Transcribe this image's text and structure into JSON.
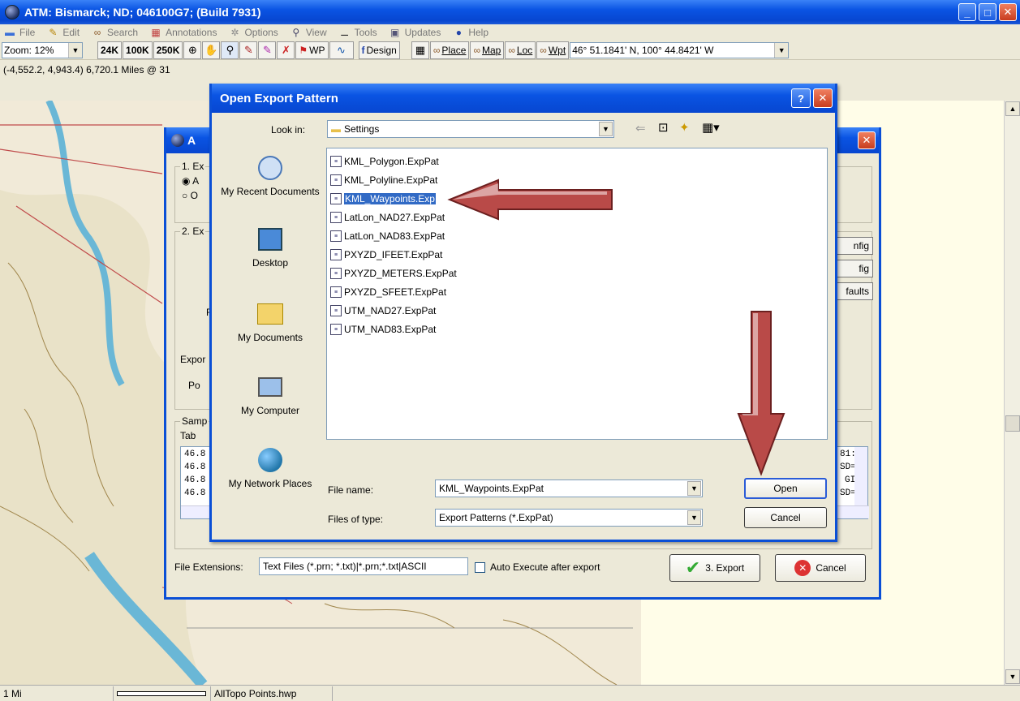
{
  "window": {
    "title": "ATM: Bismarck; ND; 046100G7; (Build 7931)"
  },
  "menu": [
    {
      "label": "File",
      "icon": "folder-icon"
    },
    {
      "label": "Edit",
      "icon": "edit-icon"
    },
    {
      "label": "Search",
      "icon": "binoculars-icon"
    },
    {
      "label": "Annotations",
      "icon": "annotations-icon"
    },
    {
      "label": "Options",
      "icon": "options-icon"
    },
    {
      "label": "View",
      "icon": "view-icon"
    },
    {
      "label": "Tools",
      "icon": "tools-icon"
    },
    {
      "label": "Updates",
      "icon": "updates-icon"
    },
    {
      "label": "Help",
      "icon": "help-icon"
    }
  ],
  "toolbar": {
    "zoom": "Zoom: 12%",
    "scale_24k": "24K",
    "scale_100k": "100K",
    "scale_250k": "250K",
    "wp": "WP",
    "design": "Design",
    "place": "Place",
    "map": "Map",
    "loc": "Loc",
    "wpt": "Wpt",
    "coords": "46° 51.1841' N, 100° 44.8421' W"
  },
  "coord_line": "(-4,552.2, 4,943.4) 6,720.1 Miles @ 31",
  "statusbar": {
    "scale": "1 Mi",
    "file": "AllTopo Points.hwp"
  },
  "export_dialog": {
    "title": "A",
    "group1": "1. Ex",
    "radio1": "A",
    "radio2": "O",
    "group2": "2. Ex",
    "label_f": "F",
    "label_expor": "Expor",
    "label_po": "Po",
    "sample_group": "Samp",
    "tabs_label": "Tab",
    "config_btn": "nfig",
    "config2_btn": "fig",
    "defaults_btn": "faults",
    "sample_rows": [
      "46.8",
      "46.8",
      "46.8",
      "46.8"
    ],
    "sample_right": [
      "81:",
      "SD=",
      "GI",
      "SD="
    ],
    "file_ext_label": "File Extensions:",
    "file_ext_value": "Text Files (*.prn; *.txt)|*.prn;*.txt|ASCII",
    "auto_execute": "Auto Execute after export",
    "export_btn": "3. Export",
    "cancel_btn": "Cancel"
  },
  "open_dialog": {
    "title": "Open Export Pattern",
    "look_in_label": "Look in:",
    "look_in_value": "Settings",
    "places": [
      {
        "label": "My Recent Documents",
        "icon": "recent-documents-icon"
      },
      {
        "label": "Desktop",
        "icon": "desktop-icon"
      },
      {
        "label": "My Documents",
        "icon": "my-documents-icon"
      },
      {
        "label": "My Computer",
        "icon": "my-computer-icon"
      },
      {
        "label": "My Network Places",
        "icon": "network-places-icon"
      }
    ],
    "files": [
      "KML_Polygon.ExpPat",
      "KML_Polyline.ExpPat",
      "KML_Waypoints.ExpPat",
      "LatLon_NAD27.ExpPat",
      "LatLon_NAD83.ExpPat",
      "PXYZD_IFEET.ExpPat",
      "PXYZD_METERS.ExpPat",
      "PXYZD_SFEET.ExpPat",
      "UTM_NAD27.ExpPat",
      "UTM_NAD83.ExpPat"
    ],
    "selected_file_label": "KML_Waypoints.Exp",
    "file_name_label": "File name:",
    "file_name_value": "KML_Waypoints.ExpPat",
    "files_of_type_label": "Files of type:",
    "files_of_type_value": "Export Patterns (*.ExpPat)",
    "open_btn": "Open",
    "cancel_btn": "Cancel"
  },
  "colors": {
    "xp_blue": "#0a54e3",
    "arrow_red": "#b94a48",
    "selection": "#316ac5"
  }
}
